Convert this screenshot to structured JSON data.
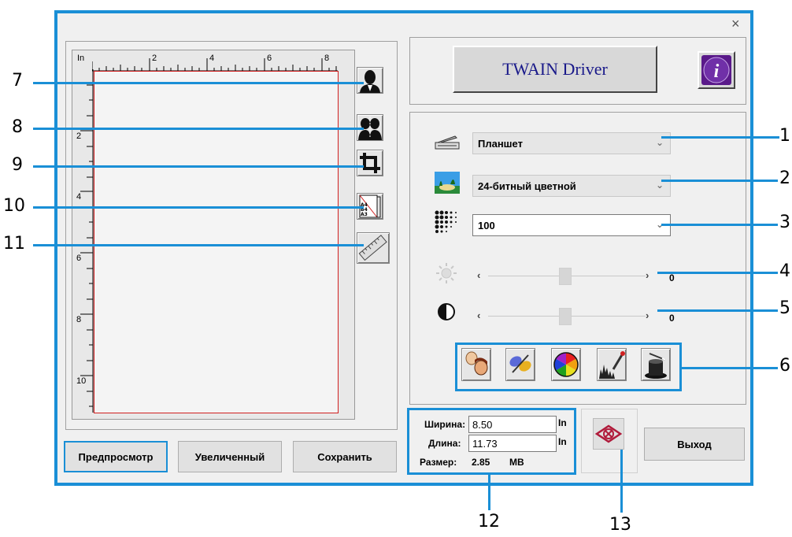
{
  "window": {
    "close_glyph": "×"
  },
  "preview": {
    "ruler_unit": "In",
    "top_ticks": [
      "2",
      "4",
      "6",
      "8"
    ],
    "left_ticks": [
      "2",
      "4",
      "6",
      "8",
      "10"
    ]
  },
  "tools": [
    "portrait-icon",
    "dual-portrait-icon",
    "crop-icon",
    "paper-size-icon",
    "ruler-icon"
  ],
  "buttons": {
    "preview": "Предпросмотр",
    "zoom": "Увеличенный",
    "save": "Сохранить",
    "exit": "Выход"
  },
  "header": {
    "twain_label": "TWAIN Driver",
    "info_glyph": "i"
  },
  "settings": {
    "source": "Планшет",
    "color_mode": "24-битный цветной",
    "resolution": "100",
    "brightness_value": "0",
    "contrast_value": "0",
    "brightness_level": 0.5,
    "contrast_level": 0.5
  },
  "size": {
    "width_label": "Ширина:",
    "width_value": "8.50",
    "width_unit": "In",
    "length_label": "Длина:",
    "length_value": "11.73",
    "length_unit": "In",
    "size_label": "Размер:",
    "size_value": "2.85",
    "size_unit": "MB"
  },
  "callouts": [
    "1",
    "2",
    "3",
    "4",
    "5",
    "6",
    "7",
    "8",
    "9",
    "10",
    "11",
    "12",
    "13"
  ],
  "colors": {
    "accent": "#1a8fd6",
    "preview_border": "#d02020",
    "twain_text": "#1a1a8a",
    "info_bg": "#5a1a8a"
  }
}
